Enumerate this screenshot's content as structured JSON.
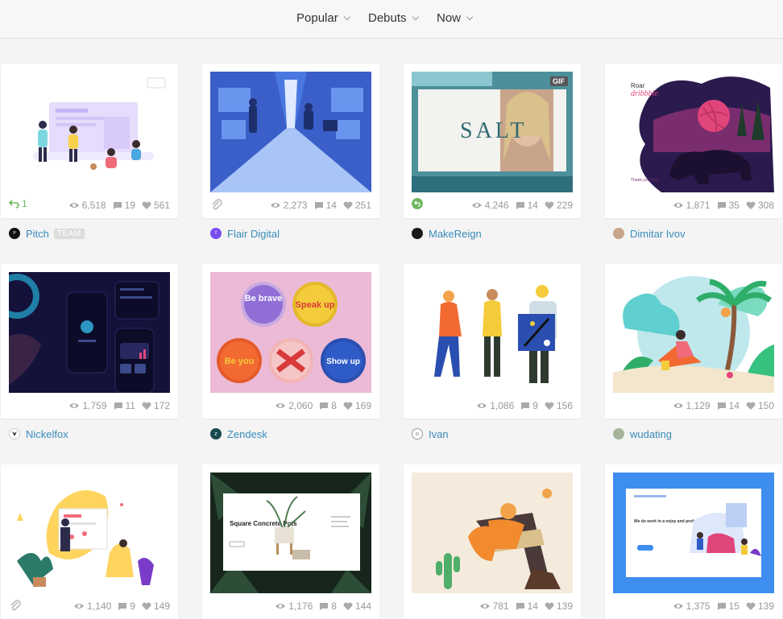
{
  "filters": {
    "sort": "Popular",
    "list": "Debuts",
    "timeframe": "Now"
  },
  "shots": [
    {
      "author": "Pitch",
      "badge": "TEAM",
      "rebound_count": "1",
      "views": "6,518",
      "comments": "19",
      "likes": "561"
    },
    {
      "author": "Flair Digital",
      "views": "2,273",
      "comments": "14",
      "likes": "251"
    },
    {
      "author": "MakeReign",
      "views": "4,246",
      "comments": "14",
      "likes": "229",
      "gif_label": "GIF",
      "title_text": "SALT"
    },
    {
      "author": "Dimitar Ivov",
      "views": "1,871",
      "comments": "35",
      "likes": "308",
      "art_text": [
        "Roar",
        "dribbble",
        "Thank you Dzh!"
      ]
    },
    {
      "author": "Nickelfox",
      "views": "1,759",
      "comments": "11",
      "likes": "172"
    },
    {
      "author": "Zendesk",
      "views": "2,060",
      "comments": "8",
      "likes": "169",
      "art_text": [
        "Be brave",
        "Speak up",
        "Be you",
        "Show up"
      ]
    },
    {
      "author": "Ivan",
      "views": "1,086",
      "comments": "9",
      "likes": "156"
    },
    {
      "author": "wudating",
      "views": "1,129",
      "comments": "14",
      "likes": "150"
    },
    {
      "views": "1,140",
      "comments": "9",
      "likes": "149"
    },
    {
      "views": "1,176",
      "comments": "8",
      "likes": "144",
      "art_text": [
        "Square Concrete Pots"
      ]
    },
    {
      "views": "781",
      "comments": "14",
      "likes": "139"
    },
    {
      "views": "1,375",
      "comments": "15",
      "likes": "139",
      "art_text": [
        "We do work in a enjoy and professional manner"
      ]
    }
  ],
  "colors": {
    "author_link": "#3a8bbb",
    "stat_gray": "#999999",
    "rebound_green": "#6db85f"
  }
}
